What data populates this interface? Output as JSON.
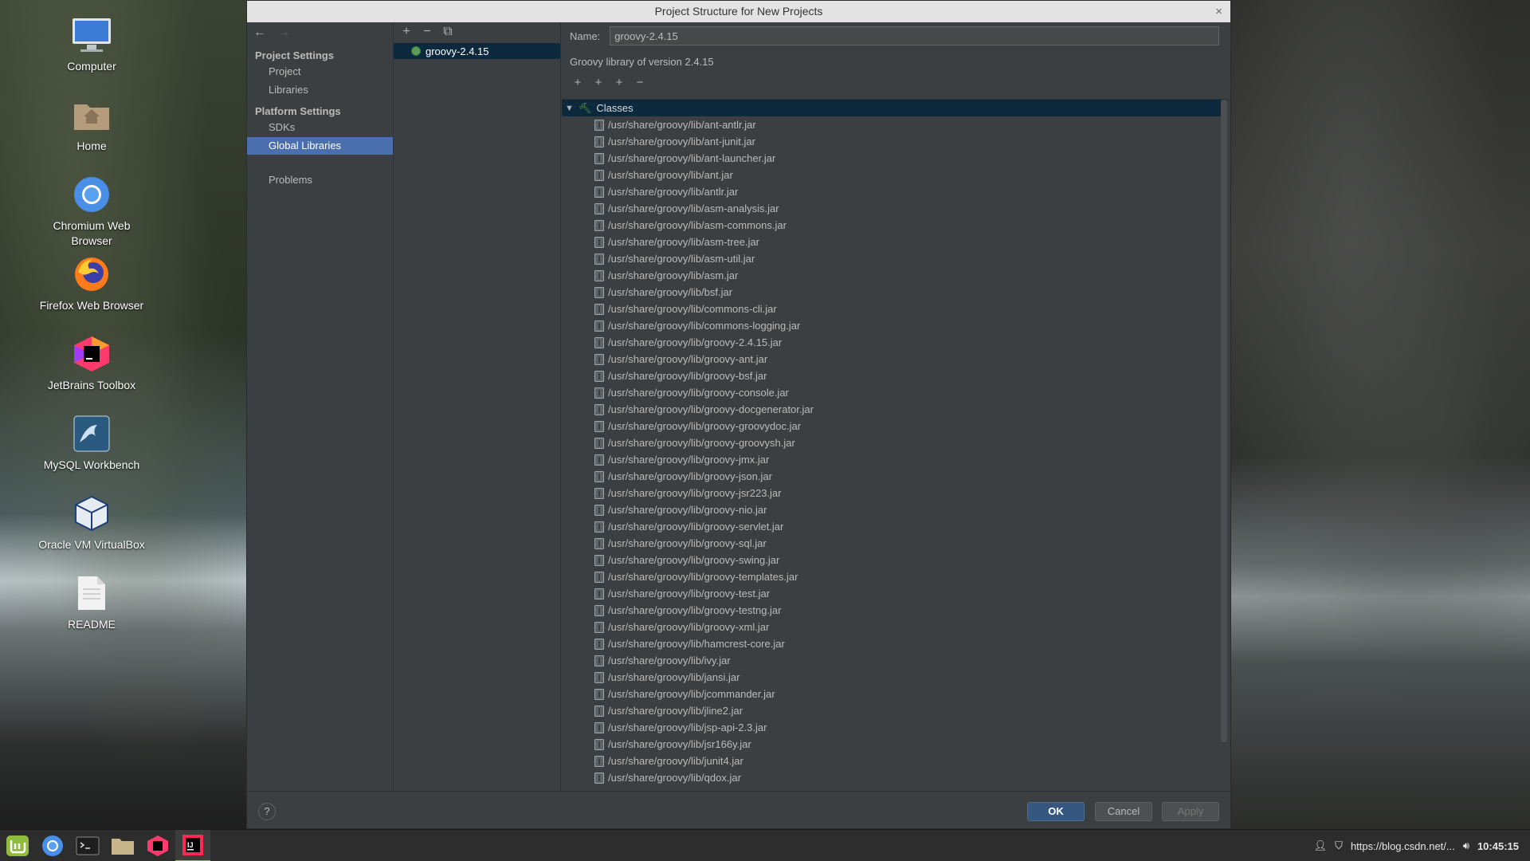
{
  "desktop": {
    "icons": [
      {
        "label": "Computer",
        "icon": "computer-icon"
      },
      {
        "label": "Home",
        "icon": "home-folder-icon"
      },
      {
        "label": "Chromium Web Browser",
        "icon": "chromium-icon"
      },
      {
        "label": "Firefox Web Browser",
        "icon": "firefox-icon"
      },
      {
        "label": "JetBrains Toolbox",
        "icon": "jetbrains-toolbox-icon"
      },
      {
        "label": "MySQL Workbench",
        "icon": "mysql-workbench-icon"
      },
      {
        "label": "Oracle VM VirtualBox",
        "icon": "virtualbox-icon"
      },
      {
        "label": "README",
        "icon": "text-file-icon"
      }
    ]
  },
  "dialog": {
    "title": "Project Structure for New Projects",
    "close_glyph": "×",
    "nav": {
      "back_glyph": "←",
      "forward_glyph": "→",
      "project_settings": "Project Settings",
      "project": "Project",
      "libraries": "Libraries",
      "platform_settings": "Platform Settings",
      "sdks": "SDKs",
      "global_libraries": "Global Libraries",
      "problems": "Problems"
    },
    "library_list": {
      "toolbar": {
        "add": "+",
        "remove": "−",
        "copy": "⧉"
      },
      "items": [
        "groovy-2.4.15"
      ]
    },
    "detail": {
      "name_label": "Name:",
      "name_value": "groovy-2.4.15",
      "description": "Groovy library of version 2.4.15",
      "toolbar": {
        "add": "+",
        "add_specific": "+",
        "add_jar": "+",
        "remove": "−"
      },
      "classes_label": "Classes",
      "jars": [
        "/usr/share/groovy/lib/ant-antlr.jar",
        "/usr/share/groovy/lib/ant-junit.jar",
        "/usr/share/groovy/lib/ant-launcher.jar",
        "/usr/share/groovy/lib/ant.jar",
        "/usr/share/groovy/lib/antlr.jar",
        "/usr/share/groovy/lib/asm-analysis.jar",
        "/usr/share/groovy/lib/asm-commons.jar",
        "/usr/share/groovy/lib/asm-tree.jar",
        "/usr/share/groovy/lib/asm-util.jar",
        "/usr/share/groovy/lib/asm.jar",
        "/usr/share/groovy/lib/bsf.jar",
        "/usr/share/groovy/lib/commons-cli.jar",
        "/usr/share/groovy/lib/commons-logging.jar",
        "/usr/share/groovy/lib/groovy-2.4.15.jar",
        "/usr/share/groovy/lib/groovy-ant.jar",
        "/usr/share/groovy/lib/groovy-bsf.jar",
        "/usr/share/groovy/lib/groovy-console.jar",
        "/usr/share/groovy/lib/groovy-docgenerator.jar",
        "/usr/share/groovy/lib/groovy-groovydoc.jar",
        "/usr/share/groovy/lib/groovy-groovysh.jar",
        "/usr/share/groovy/lib/groovy-jmx.jar",
        "/usr/share/groovy/lib/groovy-json.jar",
        "/usr/share/groovy/lib/groovy-jsr223.jar",
        "/usr/share/groovy/lib/groovy-nio.jar",
        "/usr/share/groovy/lib/groovy-servlet.jar",
        "/usr/share/groovy/lib/groovy-sql.jar",
        "/usr/share/groovy/lib/groovy-swing.jar",
        "/usr/share/groovy/lib/groovy-templates.jar",
        "/usr/share/groovy/lib/groovy-test.jar",
        "/usr/share/groovy/lib/groovy-testng.jar",
        "/usr/share/groovy/lib/groovy-xml.jar",
        "/usr/share/groovy/lib/hamcrest-core.jar",
        "/usr/share/groovy/lib/ivy.jar",
        "/usr/share/groovy/lib/jansi.jar",
        "/usr/share/groovy/lib/jcommander.jar",
        "/usr/share/groovy/lib/jline2.jar",
        "/usr/share/groovy/lib/jsp-api-2.3.jar",
        "/usr/share/groovy/lib/jsr166y.jar",
        "/usr/share/groovy/lib/junit4.jar",
        "/usr/share/groovy/lib/qdox.jar"
      ]
    },
    "buttons": {
      "help": "?",
      "ok": "OK",
      "cancel": "Cancel",
      "apply": "Apply"
    }
  },
  "taskbar": {
    "items": [
      "mint-menu-icon",
      "chromium-icon",
      "terminal-icon",
      "files-icon",
      "jetbrains-toolbox-icon",
      "intellij-idea-icon"
    ],
    "tray_text": "https://blog.csdn.net/...",
    "clock": "10:45:15"
  },
  "colors": {
    "selection": "#4b6eaf",
    "tree_selection": "#0d293e",
    "ok_button": "#365880",
    "dialog_bg": "#3c3f41"
  }
}
